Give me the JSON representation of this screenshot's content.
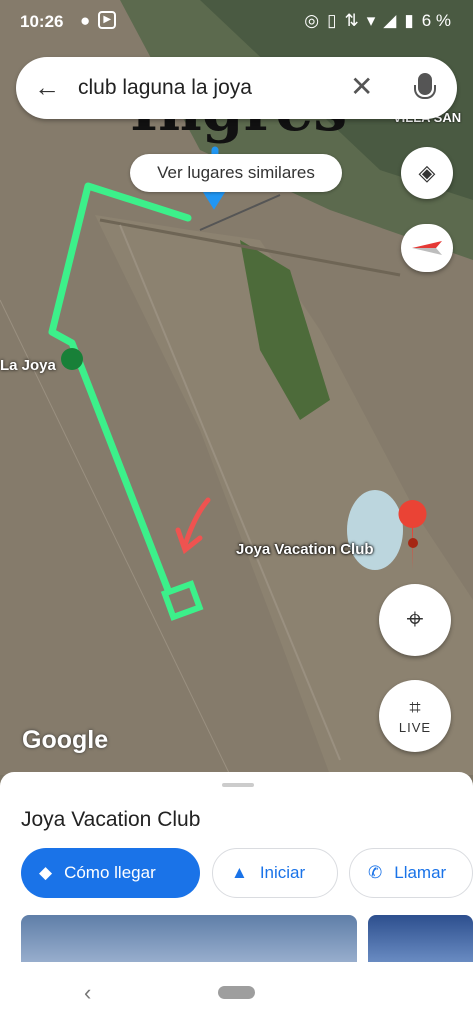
{
  "status_bar": {
    "time": "10:26",
    "battery": "6 %"
  },
  "search": {
    "query": "club laguna la joya"
  },
  "similar_places_label": "Ver lugares similares",
  "annotation": {
    "handwritten": "Ingreso"
  },
  "map": {
    "poi_label": "Joya Vacation Club",
    "area_label": "La Joya",
    "corner_label": "VILLA SAN",
    "attribution": "Google",
    "live_label": "LIVE"
  },
  "sheet": {
    "title": "Joya Vacation Club",
    "directions_label": "Cómo llegar",
    "start_label": "Iniciar",
    "call_label": "Llamar"
  },
  "colors": {
    "accent": "#1a73e8",
    "pin": "#ea4335",
    "route_drawing": "#3cf08a"
  }
}
